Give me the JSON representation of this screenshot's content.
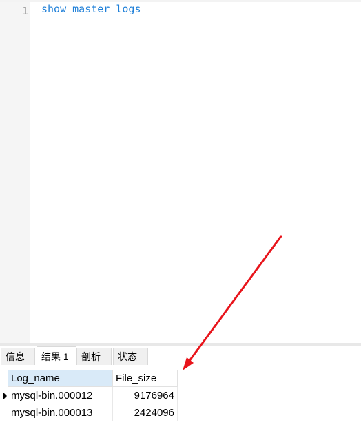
{
  "editor": {
    "line_numbers": [
      "1"
    ],
    "lines": [
      "show master logs"
    ]
  },
  "tabs": [
    {
      "label": "信息",
      "active": false
    },
    {
      "label": "结果 1",
      "active": true
    },
    {
      "label": "剖析",
      "active": false
    },
    {
      "label": "状态",
      "active": false
    }
  ],
  "result": {
    "columns": [
      "Log_name",
      "File_size"
    ],
    "rows": [
      {
        "log_name": "mysql-bin.000012",
        "file_size": "9176964",
        "current": true
      },
      {
        "log_name": "mysql-bin.000013",
        "file_size": "2424096",
        "current": false
      }
    ]
  },
  "annotation": {
    "arrow_color": "#e8141b"
  },
  "colors": {
    "sql_keyword": "#1e7fd8",
    "header_selected": "#d9eaf8"
  }
}
